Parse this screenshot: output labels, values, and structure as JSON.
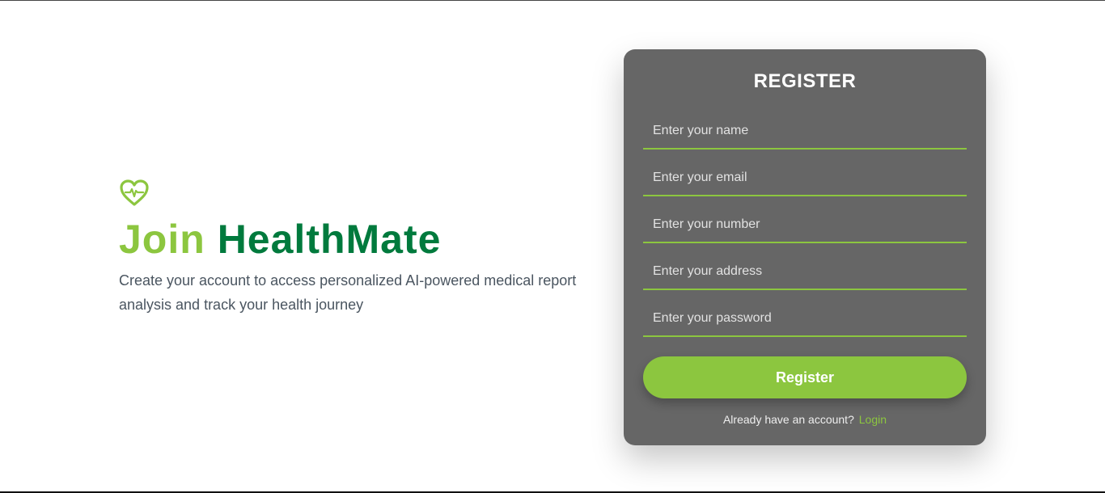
{
  "hero": {
    "icon": "heart-pulse-icon",
    "title_join": "Join",
    "title_brand": "HealthMate",
    "description": "Create your account to access personalized AI-powered medical report analysis and track your health journey"
  },
  "form": {
    "title": "REGISTER",
    "fields": [
      {
        "placeholder": "Enter your name",
        "value": ""
      },
      {
        "placeholder": "Enter your email",
        "value": ""
      },
      {
        "placeholder": "Enter your number",
        "value": ""
      },
      {
        "placeholder": "Enter your address",
        "value": ""
      },
      {
        "placeholder": "Enter your password",
        "value": ""
      }
    ],
    "submit_label": "Register",
    "login_prompt": "Already have an account?",
    "login_link": "Login"
  },
  "colors": {
    "accent_light_green": "#8cc63f",
    "accent_dark_green": "#007a3d",
    "card_bg": "#666666",
    "text_gray": "#4a5560"
  }
}
